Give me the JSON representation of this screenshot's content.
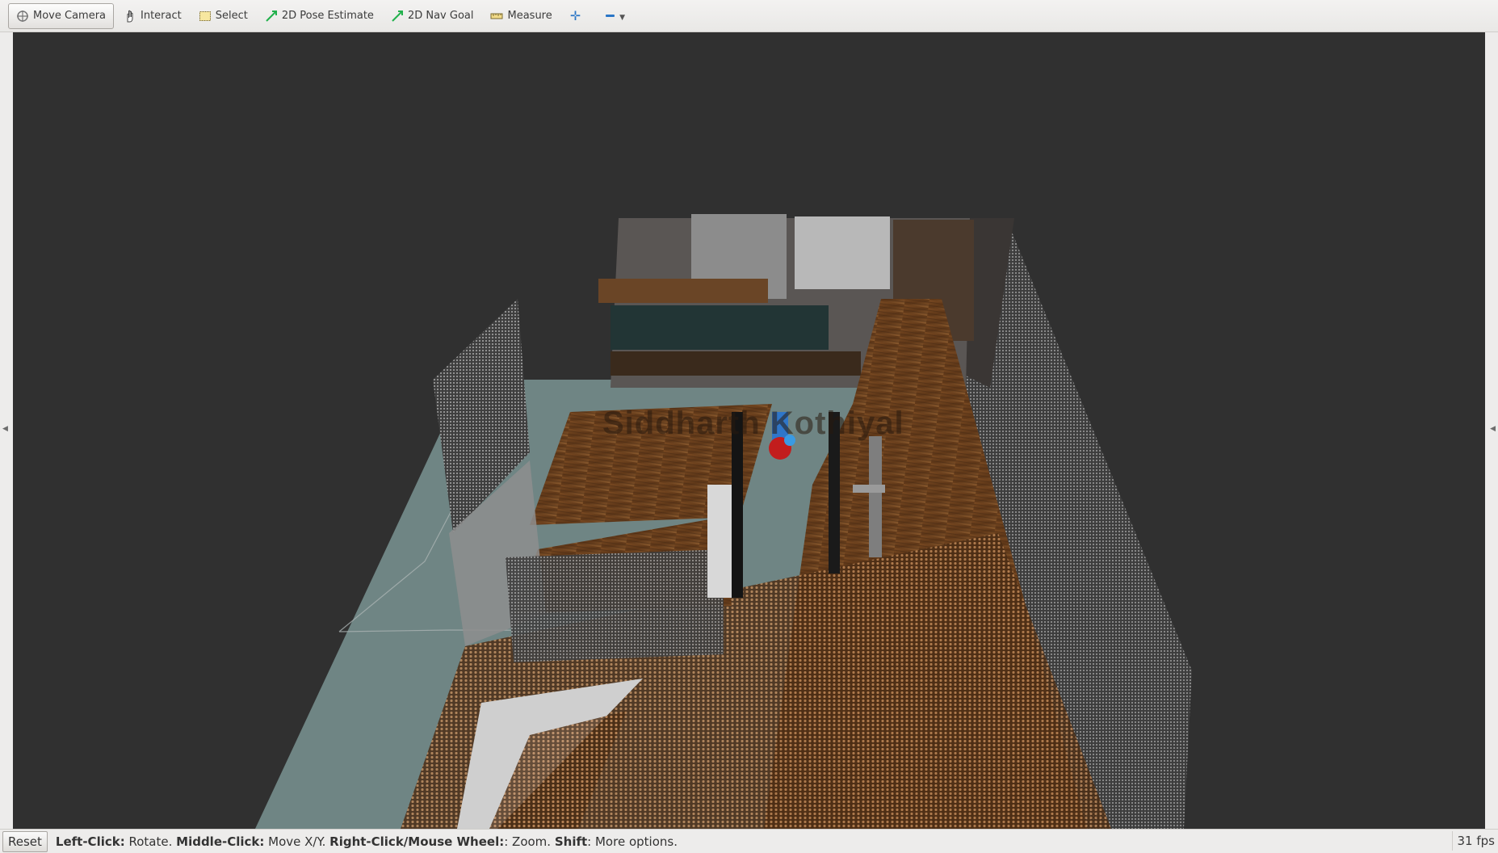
{
  "toolbar": {
    "tools": [
      {
        "label": "Move Camera",
        "icon": "move-camera-icon",
        "active": true
      },
      {
        "label": "Interact",
        "icon": "hand-icon"
      },
      {
        "label": "Select",
        "icon": "select-rect-icon"
      },
      {
        "label": "2D Pose Estimate",
        "icon": "green-arrow-icon"
      },
      {
        "label": "2D Nav Goal",
        "icon": "green-arrow-icon"
      },
      {
        "label": "Measure",
        "icon": "ruler-icon"
      }
    ],
    "add_tool_icon": "plus-icon",
    "remove_tool_icon": "minus-icon"
  },
  "viewport": {
    "watermark_text": "Siddharth Kothiyal",
    "background_color": "#303030",
    "floor_color": "#6f8584",
    "wood_color": "#6b3f1c"
  },
  "status": {
    "reset_label": "Reset",
    "hint_parts": [
      {
        "key": "Left-Click:",
        "text": " Rotate. "
      },
      {
        "key": "Middle-Click:",
        "text": " Move X/Y. "
      },
      {
        "key": "Right-Click/Mouse Wheel:",
        "text": ": Zoom. "
      },
      {
        "key": "Shift",
        "text": ": More options."
      }
    ],
    "fps": "31 fps"
  }
}
